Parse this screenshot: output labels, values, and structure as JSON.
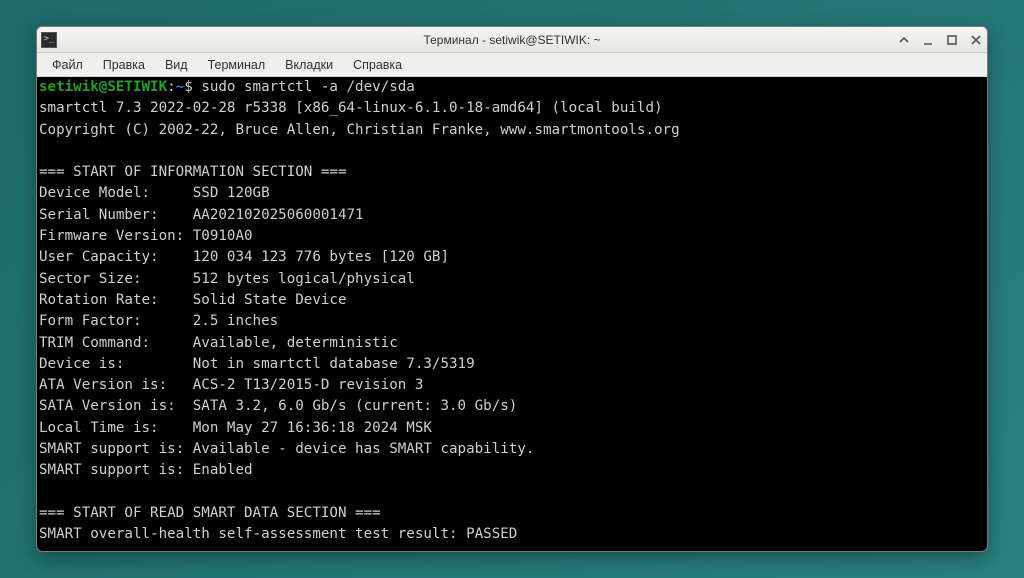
{
  "window": {
    "title": "Терминал - setiwik@SETIWIK: ~"
  },
  "menubar": {
    "items": [
      "Файл",
      "Правка",
      "Вид",
      "Терминал",
      "Вкладки",
      "Справка"
    ]
  },
  "prompt": {
    "userhost": "setiwik@SETIWIK",
    "sep1": ":",
    "path": "~",
    "sep2": "$ ",
    "command": "sudo smartctl -a /dev/sda"
  },
  "output": [
    "smartctl 7.3 2022-02-28 r5338 [x86_64-linux-6.1.0-18-amd64] (local build)",
    "Copyright (C) 2002-22, Bruce Allen, Christian Franke, www.smartmontools.org",
    "",
    "=== START OF INFORMATION SECTION ===",
    "Device Model:     SSD 120GB",
    "Serial Number:    AA202102025060001471",
    "Firmware Version: T0910A0",
    "User Capacity:    120 034 123 776 bytes [120 GB]",
    "Sector Size:      512 bytes logical/physical",
    "Rotation Rate:    Solid State Device",
    "Form Factor:      2.5 inches",
    "TRIM Command:     Available, deterministic",
    "Device is:        Not in smartctl database 7.3/5319",
    "ATA Version is:   ACS-2 T13/2015-D revision 3",
    "SATA Version is:  SATA 3.2, 6.0 Gb/s (current: 3.0 Gb/s)",
    "Local Time is:    Mon May 27 16:36:18 2024 MSK",
    "SMART support is: Available - device has SMART capability.",
    "SMART support is: Enabled",
    "",
    "=== START OF READ SMART DATA SECTION ===",
    "SMART overall-health self-assessment test result: PASSED"
  ]
}
